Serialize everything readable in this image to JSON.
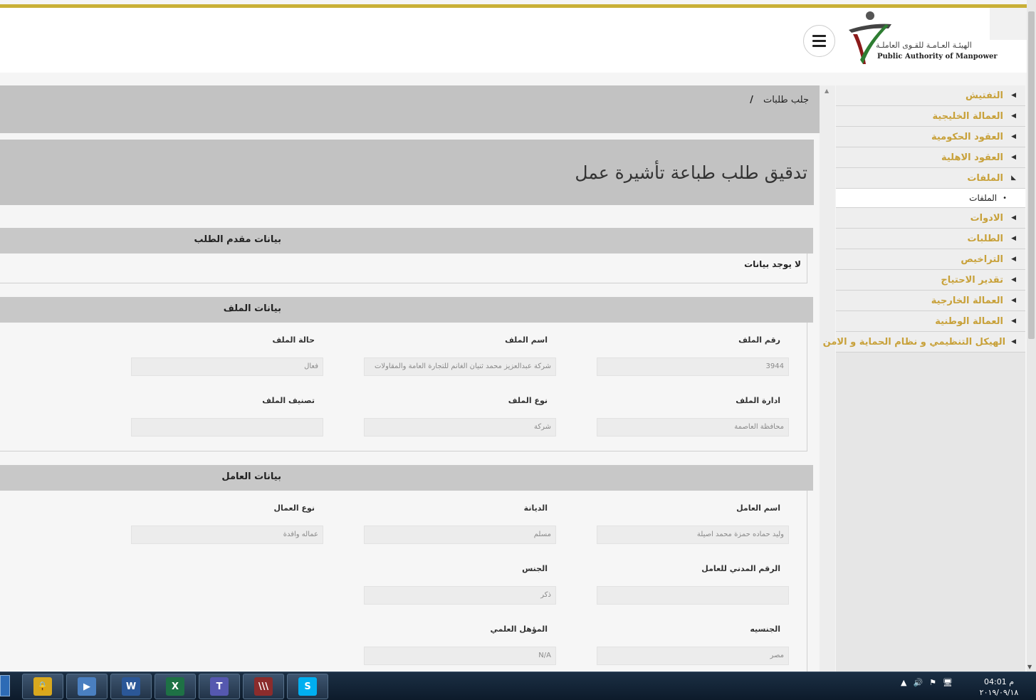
{
  "header": {
    "logo_ar": "الهيئـة العـامـة للقـوى العاملـة",
    "logo_en": "Public Authority of Manpower"
  },
  "sidebar": {
    "items": [
      {
        "label": "التفتيش",
        "expanded": false
      },
      {
        "label": "العمالة الخليجية",
        "expanded": false
      },
      {
        "label": "العقود الحكومية",
        "expanded": false
      },
      {
        "label": "العقود الاهلية",
        "expanded": false
      },
      {
        "label": "الملفات",
        "expanded": true,
        "sub": "الملفات"
      },
      {
        "label": "الادوات",
        "expanded": false
      },
      {
        "label": "الطلبات",
        "expanded": false
      },
      {
        "label": "التراخيص",
        "expanded": false
      },
      {
        "label": "تقدير الاحتياج",
        "expanded": false
      },
      {
        "label": "العمالة الخارجية",
        "expanded": false
      },
      {
        "label": "العمالة الوطنية",
        "expanded": false
      },
      {
        "label": "الهيكل التنظيمي و نظام الحماية و الامن",
        "expanded": false
      }
    ]
  },
  "breadcrumb": {
    "current": "جلب طلبات",
    "separator": "/"
  },
  "page_title": "تدقيق طلب طباعة تأشيرة عمل",
  "applicant": {
    "title": "بيانات مقدم الطلب",
    "empty": "لا يوجد بيانات"
  },
  "file": {
    "title": "بيانات الملف",
    "number_label": "رقم الملف",
    "number": "3944",
    "name_label": "اسم الملف",
    "name": "شركة عبدالعزيز محمد ثنيان الغانم للتجارة العامة والمقاولات",
    "status_label": "حالة الملف",
    "status": "فعال",
    "admin_label": "ادارة الملف",
    "admin": "محافظة العاصمة",
    "type_label": "نوع الملف",
    "type": "شركة",
    "class_label": "تصنيف الملف",
    "class": ""
  },
  "worker": {
    "title": "بيانات العامل",
    "name_label": "اسم العامل",
    "name": "وليد حماده حمزة محمد اصيلة",
    "religion_label": "الديانة",
    "religion": "مسلم",
    "labor_type_label": "نوع العمال",
    "labor_type": "عماله وافدة",
    "civil_id_label": "الرقم المدني للعامل",
    "civil_id": "",
    "gender_label": "الجنس",
    "gender": "ذكر",
    "nationality_label": "الجنسيه",
    "nationality": "مصر",
    "qualification_label": "المؤهل العلمي",
    "qualification": "N/A"
  },
  "taskbar": {
    "apps": [
      {
        "name": "lock-app",
        "glyph": "🔒",
        "color": "#d8a81e"
      },
      {
        "name": "media-app",
        "glyph": "▶",
        "color": "#4a7fc0"
      },
      {
        "name": "word-app",
        "glyph": "W",
        "color": "#2b5797"
      },
      {
        "name": "excel-app",
        "glyph": "X",
        "color": "#1e7145"
      },
      {
        "name": "teams-app",
        "glyph": "T",
        "color": "#5558af"
      },
      {
        "name": "stripes-app",
        "glyph": "\\\\\\",
        "color": "#8b2c2c"
      },
      {
        "name": "skype-app",
        "glyph": "S",
        "color": "#00aff0"
      }
    ],
    "time": "04:01 م",
    "date": "٢٠١٩/٠٩/١٨"
  }
}
